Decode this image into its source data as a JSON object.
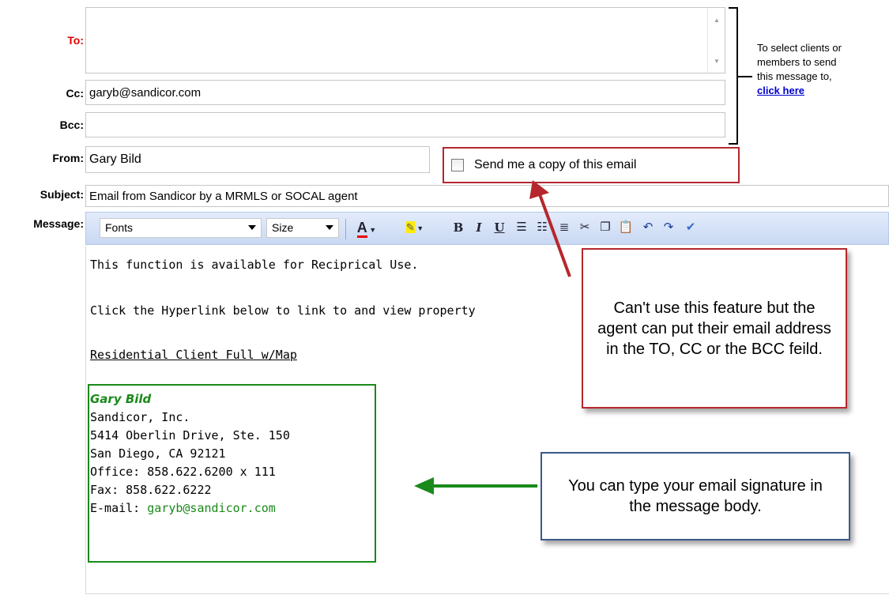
{
  "form": {
    "to_label": "To:",
    "cc_label": "Cc:",
    "cc_value": "garyb@sandicor.com",
    "bcc_label": "Bcc:",
    "bcc_value": "",
    "from_label": "From:",
    "from_value": "Gary Bild",
    "copy_label": "Send me a copy of this email",
    "subject_label": "Subject:",
    "subject_value": "Email from Sandicor by a MRMLS or SOCAL agent",
    "message_label": "Message:"
  },
  "side_note": {
    "line1": "To select clients or",
    "line2": "members to send",
    "line3": "this message to,",
    "link": "click here"
  },
  "toolbar": {
    "fonts": "Fonts",
    "size": "Size",
    "icons": [
      "font-color-icon",
      "highlight-icon",
      "bold-icon",
      "italic-icon",
      "underline-icon",
      "numbered-list-icon",
      "bullet-list-icon",
      "indent-icon",
      "cut-icon",
      "copy-icon",
      "paste-icon",
      "undo-icon",
      "redo-icon",
      "spellcheck-icon"
    ]
  },
  "message": {
    "line1": "This function is available for Reciprical Use.",
    "line2": "Click the Hyperlink below to link to and view property",
    "link": "Residential Client Full w/Map",
    "sig_name": "Gary Bild",
    "sig_company": "Sandicor, Inc.",
    "sig_address": "5414 Oberlin Drive, Ste. 150",
    "sig_city": "San Diego, CA 92121",
    "sig_office": "Office: 858.622.6200 x 111",
    "sig_fax": "Fax: 858.622.6222",
    "sig_email_label": "E-mail: ",
    "sig_email": "garyb@sandicor.com"
  },
  "callouts": {
    "copy_note": "Can't use this feature but the agent can put their email address in the TO, CC or the BCC feild.",
    "signature_note": "You can type your email signature in the message body."
  },
  "colors": {
    "to_label": "#e00000",
    "callout_red": "#b5272d",
    "callout_green": "#1a8a1a",
    "callout_blue": "#3b5a8c",
    "signature_green": "#1a8a1a"
  }
}
